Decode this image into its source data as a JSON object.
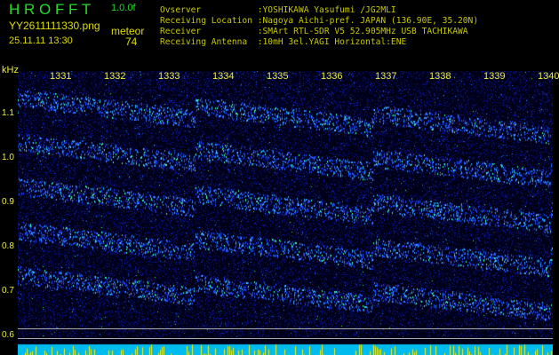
{
  "header": {
    "title": "H R O F F T",
    "version": "1.0.0f",
    "filename": "YY2611111330.png",
    "datetime": "25.11.11 13:30",
    "meteor_label": "meteor",
    "meteor_count": "74"
  },
  "info": [
    "Ovserver           :YOSHIKAWA Yasufumi /JG2MLI",
    "Receiving Location :Nagoya Aichi-pref. JAPAN (136.90E, 35.20N)",
    "Receiver           :SMArt RTL-SDR V5 52.905MHz USB TACHIKAWA",
    "Receiving Antenna  :10mH 3el.YAGI Horizontal:ENE"
  ],
  "axis": {
    "y_unit": "kHz",
    "x_ticks": [
      "1331",
      "1332",
      "1333",
      "1334",
      "1335",
      "1336",
      "1337",
      "1338",
      "1339",
      "1340"
    ],
    "y_ticks": [
      "1.1",
      "1.0",
      "0.9",
      "0.8",
      "0.7",
      "0.6"
    ]
  },
  "colors": {
    "text": "#dddd00",
    "title": "#22dd22",
    "background": "#000000"
  }
}
